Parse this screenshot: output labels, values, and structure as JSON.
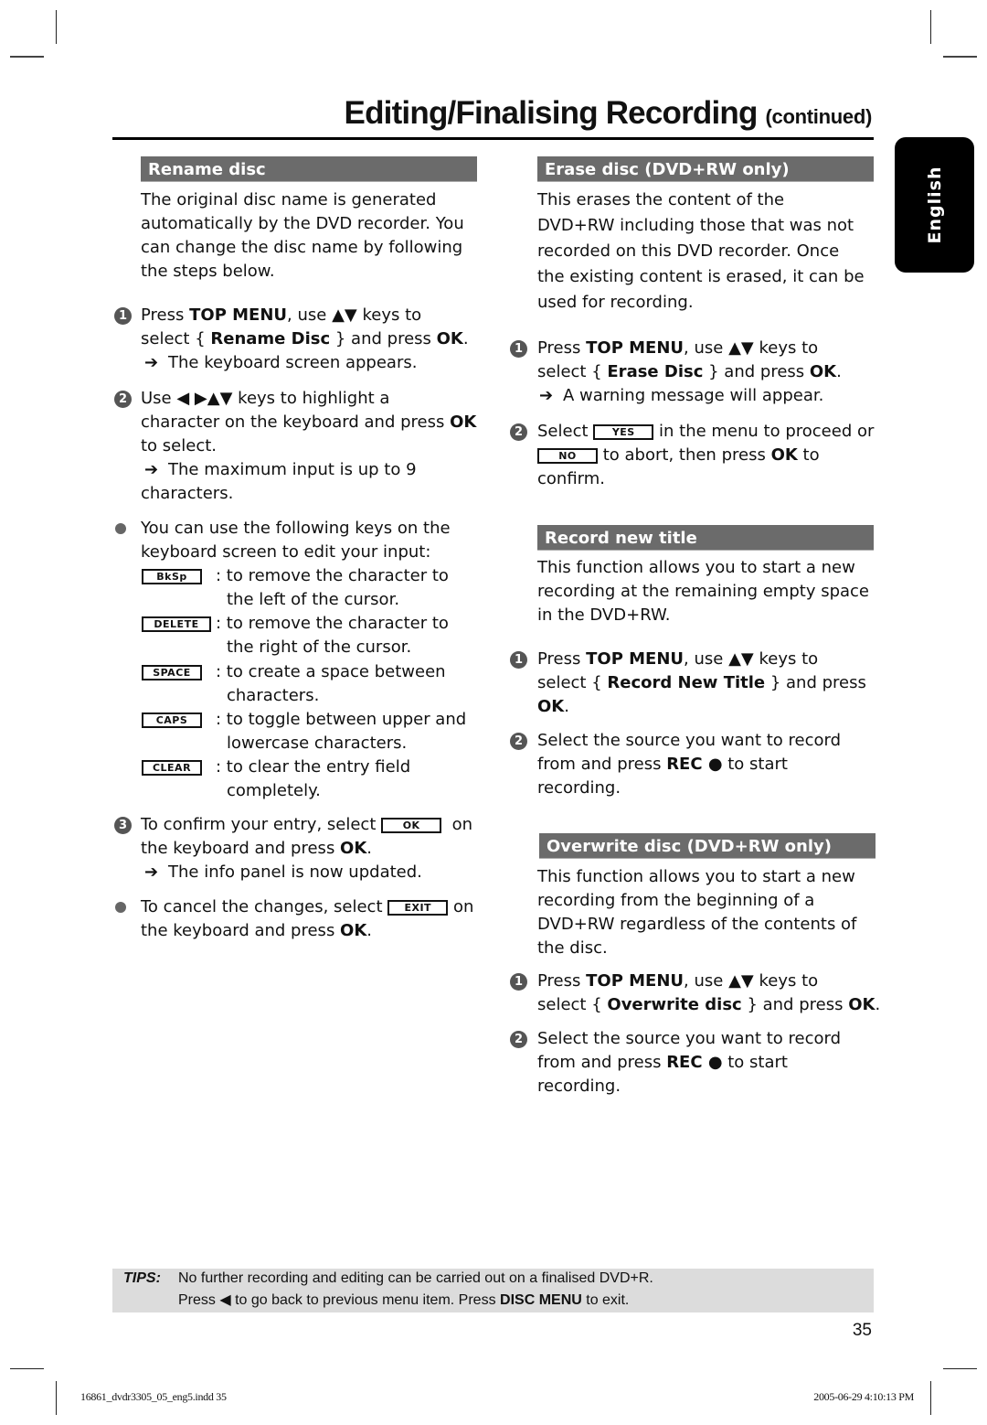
{
  "header": {
    "title": "Editing/Finalising Recording",
    "continued": "(continued)",
    "language_tab": "English"
  },
  "rename_disc": {
    "heading": "Rename disc",
    "intro": [
      "The original disc name is generated",
      "automatically by the DVD recorder. You",
      "can change the disc name by following",
      "the steps below."
    ],
    "step1": {
      "number": "1",
      "line1_pre": "Press ",
      "line1_bold": "TOP MENU",
      "line1_post": ", use ▲▼ keys to",
      "line2_pre": "select { ",
      "line2_bold": "Rename Disc",
      "line2_mid": " } and press ",
      "line2_bold2": "OK",
      "line2_post": ".",
      "result": "The keyboard screen appears."
    },
    "step2": {
      "number": "2",
      "line1": "Use ◀ ▶▲▼ keys to highlight a",
      "line2_pre": "character on the keyboard and press ",
      "line2_bold": "OK",
      "line3": "to select.",
      "result_line1": "The maximum input is up to 9",
      "result_line2": "characters."
    },
    "keys_note": {
      "line1": "You can use the following keys on the",
      "line2": "keyboard screen to edit your input:"
    },
    "keys": [
      {
        "key": "BkSp",
        "desc1": ": to remove the character to",
        "desc2": "the left of the cursor."
      },
      {
        "key": "DELETE",
        "desc1": ": to remove the character to",
        "desc2": "the right of the cursor."
      },
      {
        "key": "SPACE",
        "desc1": ": to create a space between",
        "desc2": "characters."
      },
      {
        "key": "CAPS",
        "desc1": ": to toggle between upper and",
        "desc2": "lowercase characters."
      },
      {
        "key": "CLEAR",
        "desc1": ": to clear the entry field",
        "desc2": "completely."
      }
    ],
    "step3": {
      "number": "3",
      "line1_pre": "To confirm your entry, select",
      "key": "OK",
      "line1_post": "on",
      "line2_pre": "the keyboard and press ",
      "line2_bold": "OK",
      "line2_post": ".",
      "result": "The info panel is now updated."
    },
    "cancel_note": {
      "line1_pre": "To cancel the changes, select",
      "key": "EXIT",
      "line1_post": "on",
      "line2_pre": "the keyboard and press ",
      "line2_bold": "OK",
      "line2_post": "."
    }
  },
  "erase_disc": {
    "heading": "Erase disc (DVD+RW only)",
    "intro": [
      "This erases the content of the",
      "DVD+RW including those that was not",
      "recorded on this DVD recorder. Once",
      "the existing content is erased, it can be",
      "used for recording."
    ],
    "step1": {
      "number": "1",
      "line1_pre": "Press ",
      "line1_bold": "TOP MENU",
      "line1_post": ", use ▲▼ keys to",
      "line2_pre": "select { ",
      "line2_bold": "Erase Disc",
      "line2_mid": " } and press ",
      "line2_bold2": "OK",
      "line2_post": ".",
      "result": "A warning message will appear."
    },
    "step2": {
      "number": "2",
      "line1_pre": "Select",
      "key_yes": "YES",
      "line1_post": "in the menu to proceed or",
      "key_no": "NO",
      "line2_pre": "to abort, then press ",
      "line2_bold": "OK",
      "line2_post": " to",
      "line3": "confirm."
    }
  },
  "record_new_title": {
    "heading": "Record new title",
    "intro": [
      "This function allows you to start a new",
      "recording at the remaining empty space",
      "in the DVD+RW."
    ],
    "step1": {
      "number": "1",
      "line1_pre": "Press ",
      "line1_bold": "TOP MENU",
      "line1_post": ", use ▲▼ keys to",
      "line2_pre": "select { ",
      "line2_bold": "Record New Title",
      "line2_post": " } and press",
      "line3_bold": "OK",
      "line3_post": "."
    },
    "step2": {
      "number": "2",
      "line1": "Select the source you want to record",
      "line2_pre": "from and press ",
      "line2_bold": "REC ●",
      "line2_post": " to start",
      "line3": "recording."
    }
  },
  "overwrite_disc": {
    "heading": "Overwrite disc (DVD+RW only)",
    "intro": [
      "This function allows you to start a new",
      "recording from the beginning of a",
      "DVD+RW regardless of the contents of",
      "the disc."
    ],
    "step1": {
      "number": "1",
      "line1_pre": "Press ",
      "line1_bold": "TOP MENU",
      "line1_post": ", use ▲▼ keys to",
      "line2_pre": "select { ",
      "line2_bold": "Overwrite disc",
      "line2_mid": " } and press ",
      "line2_bold2": "OK",
      "line2_post": "."
    },
    "step2": {
      "number": "2",
      "line1": "Select the source you want to record",
      "line2_pre": "from and press ",
      "line2_bold": "REC ●",
      "line2_post": " to start",
      "line3": "recording."
    }
  },
  "tips": {
    "label": "TIPS:",
    "line1": "No further recording and editing can be carried out on a finalised DVD+R.",
    "line2_pre": "Press ◀ to go back to previous menu item. Press ",
    "line2_bold": "DISC MENU",
    "line2_post": " to exit."
  },
  "page_number": "35",
  "slug": {
    "file": "16861_dvdr3305_05_eng5.indd   35",
    "timestamp": "2005-06-29   4:10:13 PM"
  },
  "arrow_glyph": "➔"
}
